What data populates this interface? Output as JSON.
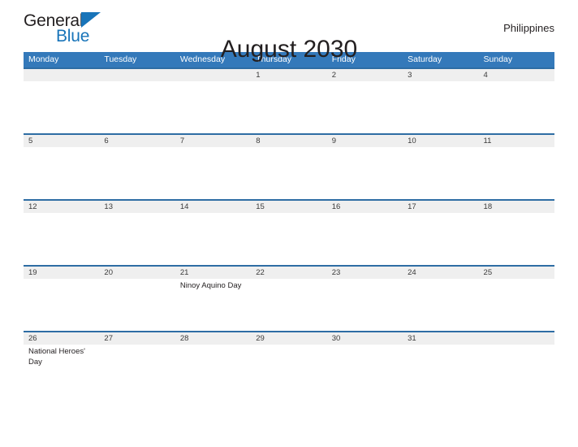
{
  "brand": {
    "name_part1": "General",
    "name_part2": "Blue",
    "triangle_color": "#1874b9"
  },
  "header": {
    "title": "August 2030",
    "locale": "Philippines"
  },
  "theme": {
    "header_blue": "#3479ba",
    "date_band_gray": "#efefef",
    "rule_blue": "#2e6da4",
    "text_dark": "#231f20"
  },
  "calendar": {
    "month": "August",
    "year": "2030",
    "day_headers": [
      "Monday",
      "Tuesday",
      "Wednesday",
      "Thursday",
      "Friday",
      "Saturday",
      "Sunday"
    ],
    "weeks": [
      {
        "days": [
          {
            "num": "",
            "event": ""
          },
          {
            "num": "",
            "event": ""
          },
          {
            "num": "",
            "event": ""
          },
          {
            "num": "1",
            "event": ""
          },
          {
            "num": "2",
            "event": ""
          },
          {
            "num": "3",
            "event": ""
          },
          {
            "num": "4",
            "event": ""
          }
        ]
      },
      {
        "days": [
          {
            "num": "5",
            "event": ""
          },
          {
            "num": "6",
            "event": ""
          },
          {
            "num": "7",
            "event": ""
          },
          {
            "num": "8",
            "event": ""
          },
          {
            "num": "9",
            "event": ""
          },
          {
            "num": "10",
            "event": ""
          },
          {
            "num": "11",
            "event": ""
          }
        ]
      },
      {
        "days": [
          {
            "num": "12",
            "event": ""
          },
          {
            "num": "13",
            "event": ""
          },
          {
            "num": "14",
            "event": ""
          },
          {
            "num": "15",
            "event": ""
          },
          {
            "num": "16",
            "event": ""
          },
          {
            "num": "17",
            "event": ""
          },
          {
            "num": "18",
            "event": ""
          }
        ]
      },
      {
        "days": [
          {
            "num": "19",
            "event": ""
          },
          {
            "num": "20",
            "event": ""
          },
          {
            "num": "21",
            "event": "Ninoy Aquino Day"
          },
          {
            "num": "22",
            "event": ""
          },
          {
            "num": "23",
            "event": ""
          },
          {
            "num": "24",
            "event": ""
          },
          {
            "num": "25",
            "event": ""
          }
        ]
      },
      {
        "days": [
          {
            "num": "26",
            "event": "National Heroes' Day"
          },
          {
            "num": "27",
            "event": ""
          },
          {
            "num": "28",
            "event": ""
          },
          {
            "num": "29",
            "event": ""
          },
          {
            "num": "30",
            "event": ""
          },
          {
            "num": "31",
            "event": ""
          },
          {
            "num": "",
            "event": ""
          }
        ]
      }
    ]
  }
}
